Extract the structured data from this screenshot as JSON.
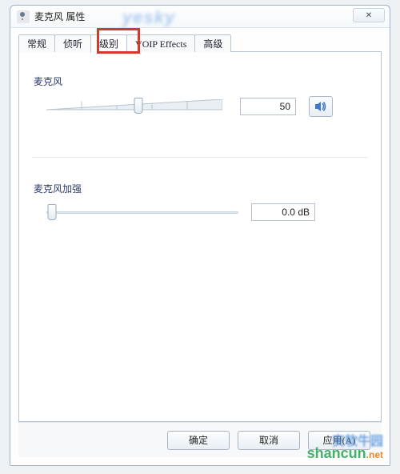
{
  "window": {
    "title": "麦克风 属性",
    "close_glyph": "✕"
  },
  "tabs": [
    {
      "label": "常规"
    },
    {
      "label": "侦听"
    },
    {
      "label": "级别"
    },
    {
      "label": "VOIP Effects"
    },
    {
      "label": "高级"
    }
  ],
  "active_tab_index": 2,
  "level": {
    "mic_label": "麦克风",
    "mic_value": "50",
    "mic_slider_percent": 50,
    "speaker_icon_name": "speaker-icon",
    "boost_label": "麦克风加强",
    "boost_value": "0.0 dB",
    "boost_slider_percent": 0
  },
  "buttons": {
    "ok": "确定",
    "cancel": "取消",
    "apply": "应用(A)"
  },
  "watermarks": {
    "top": "yesky",
    "corner_line1": "安软牛园",
    "corner_line2": "shancun",
    "corner_suffix": ".net"
  }
}
